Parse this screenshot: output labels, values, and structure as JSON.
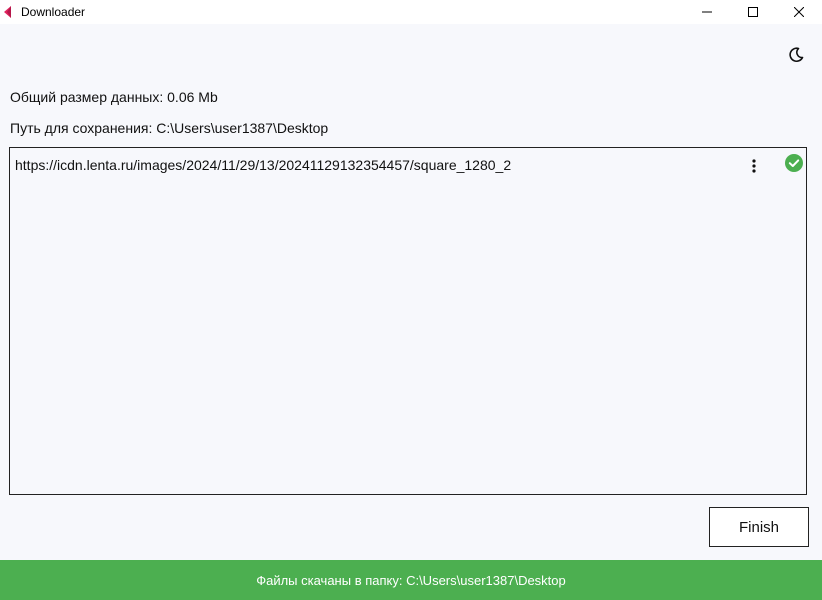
{
  "window": {
    "title": "Downloader",
    "controls": [
      "minimize",
      "maximize",
      "close"
    ]
  },
  "header": {
    "theme_toggle_icon": "moon-icon"
  },
  "info": {
    "total_size": "Общий размер данных: 0.06 Mb",
    "save_path": "Путь для сохранения: C:\\Users\\user1387\\Desktop"
  },
  "downloads": [
    {
      "url": "https://icdn.lenta.ru/images/2024/11/29/13/20241129132354457/square_1280_2",
      "menu_icon": "more-vert-icon",
      "status_icon": "check-circle-icon",
      "status": "completed"
    }
  ],
  "actions": {
    "finish_label": "Finish"
  },
  "status_bar": {
    "text": "Файлы скачаны в папку: C:\\Users\\user1387\\Desktop",
    "color": "#4caf50"
  },
  "colors": {
    "background": "#f7f8fc",
    "success": "#4caf50",
    "app_icon": "#e0245e"
  }
}
